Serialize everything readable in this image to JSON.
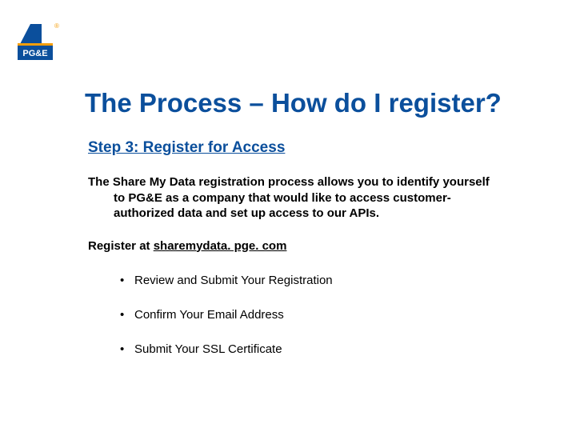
{
  "logo": {
    "brand_text": "PG&E",
    "registered_mark": "®",
    "beam_color": "#0b4f9c",
    "band_color": "#f59e0b",
    "text_bg": "#0b4f9c"
  },
  "title": "The Process – How do I register?",
  "subtitle": "Step 3: Register for Access",
  "paragraph": "The Share My Data registration process allows you to identify yourself to PG&E as a company that would like to access customer-authorized data and set up access to our APIs.",
  "register": {
    "prefix": "Register at ",
    "url": "sharemydata. pge. com"
  },
  "bullets": [
    "Review and Submit Your Registration",
    "Confirm Your Email Address",
    "Submit Your SSL Certificate"
  ]
}
